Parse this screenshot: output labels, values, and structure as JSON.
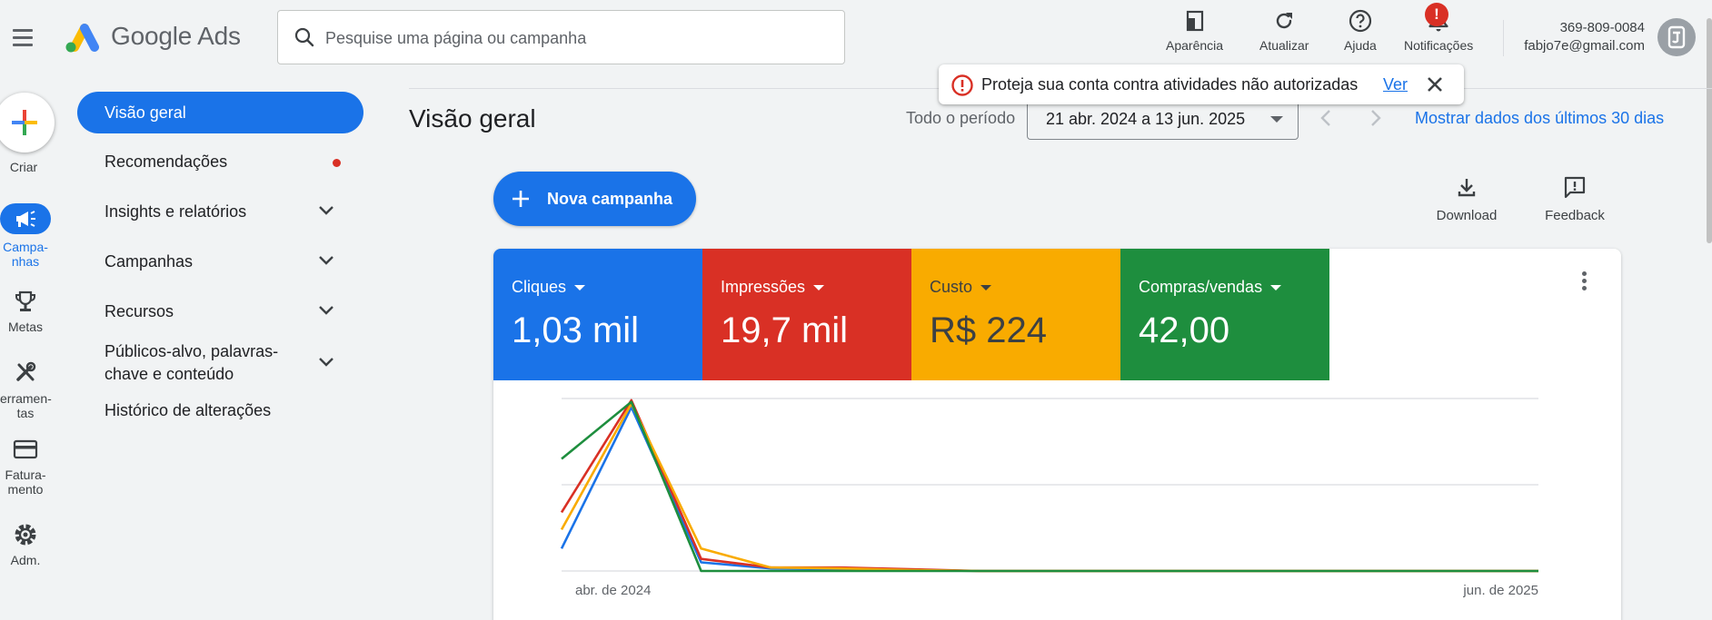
{
  "header": {
    "app_name": "Google Ads",
    "search_placeholder": "Pesquise uma página ou campanha",
    "buttons": [
      {
        "label": "Aparência",
        "icon": "appearance-icon"
      },
      {
        "label": "Atualizar",
        "icon": "refresh-icon"
      },
      {
        "label": "Ajuda",
        "icon": "help-icon"
      },
      {
        "label": "Notificações",
        "icon": "bell-icon",
        "badge": "!"
      }
    ],
    "account_id": "369-809-0084",
    "account_email": "fabjo7e@gmail.com"
  },
  "rail": {
    "create_label": "Criar",
    "items": [
      {
        "label_l1": "Campa-",
        "label_l2": "nhas",
        "icon": "campaigns-icon"
      },
      {
        "label_l1": "Metas",
        "label_l2": "",
        "icon": "trophy-icon"
      },
      {
        "label_l1": "erramen-",
        "label_l2": "tas",
        "icon": "tools-icon"
      },
      {
        "label_l1": "Fatura-",
        "label_l2": "mento",
        "icon": "billing-icon"
      },
      {
        "label_l1": "Adm.",
        "label_l2": "",
        "icon": "settings-icon"
      }
    ]
  },
  "nav": {
    "items": [
      {
        "label": "Visão geral",
        "active": true
      },
      {
        "label": "Recomendações",
        "dot": true
      },
      {
        "label": "Insights e relatórios",
        "expandable": true
      },
      {
        "label": "Campanhas",
        "expandable": true
      },
      {
        "label": "Recursos",
        "expandable": true
      },
      {
        "label_l1": "Públicos-alvo, palavras-",
        "label_l2": "chave e conteúdo",
        "expandable": true
      },
      {
        "label": "Histórico de alterações"
      }
    ]
  },
  "alert": {
    "message": "Proteja sua conta contra atividades não autorizadas",
    "link": "Ver"
  },
  "main": {
    "title": "Visão geral",
    "period_label": "Todo o período",
    "date_range": "21 abr. 2024 a 13 jun. 2025",
    "last30_link": "Mostrar dados dos últimos 30 dias",
    "new_campaign": "Nova campanha",
    "download": "Download",
    "feedback": "Feedback"
  },
  "metrics": [
    {
      "label": "Cliques",
      "value": "1,03 mil",
      "color": "#1a73e8"
    },
    {
      "label": "Impressões",
      "value": "19,7 mil",
      "color": "#d93025"
    },
    {
      "label": "Custo",
      "value": "R$ 224",
      "color": "#f9ab00"
    },
    {
      "label": "Compras/vendas",
      "value": "42,00",
      "color": "#1e8e3e"
    }
  ],
  "chart_data": {
    "type": "line",
    "x_labels": [
      "abr. de 2024",
      "jun. de 2025"
    ],
    "x": [
      0,
      1,
      2,
      3,
      4,
      5,
      6,
      7,
      8,
      9,
      10,
      11,
      12,
      13,
      14
    ],
    "series": [
      {
        "name": "Cliques",
        "color": "#1a73e8",
        "values": [
          0.13,
          0.95,
          0.05,
          0.015,
          0.01,
          0.005,
          0.0,
          0.0,
          0.0,
          0.0,
          0.0,
          0.0,
          0.0,
          0.0,
          0.0
        ]
      },
      {
        "name": "Impressões",
        "color": "#d93025",
        "values": [
          0.34,
          0.99,
          0.07,
          0.02,
          0.02,
          0.01,
          0.0,
          0.0,
          0.0,
          0.0,
          0.0,
          0.0,
          0.0,
          0.0,
          0.0
        ]
      },
      {
        "name": "Custo",
        "color": "#f9ab00",
        "values": [
          0.24,
          0.97,
          0.13,
          0.02,
          0.015,
          0.005,
          0.0,
          0.0,
          0.0,
          0.0,
          0.0,
          0.0,
          0.0,
          0.0,
          0.0
        ]
      },
      {
        "name": "Compras/vendas",
        "color": "#1e8e3e",
        "values": [
          0.65,
          0.98,
          0.0,
          0.0,
          0.0,
          0.0,
          0.0,
          0.0,
          0.0,
          0.0,
          0.0,
          0.0,
          0.0,
          0.0,
          0.0
        ]
      }
    ],
    "ylim": [
      0,
      1
    ],
    "grid": true
  }
}
